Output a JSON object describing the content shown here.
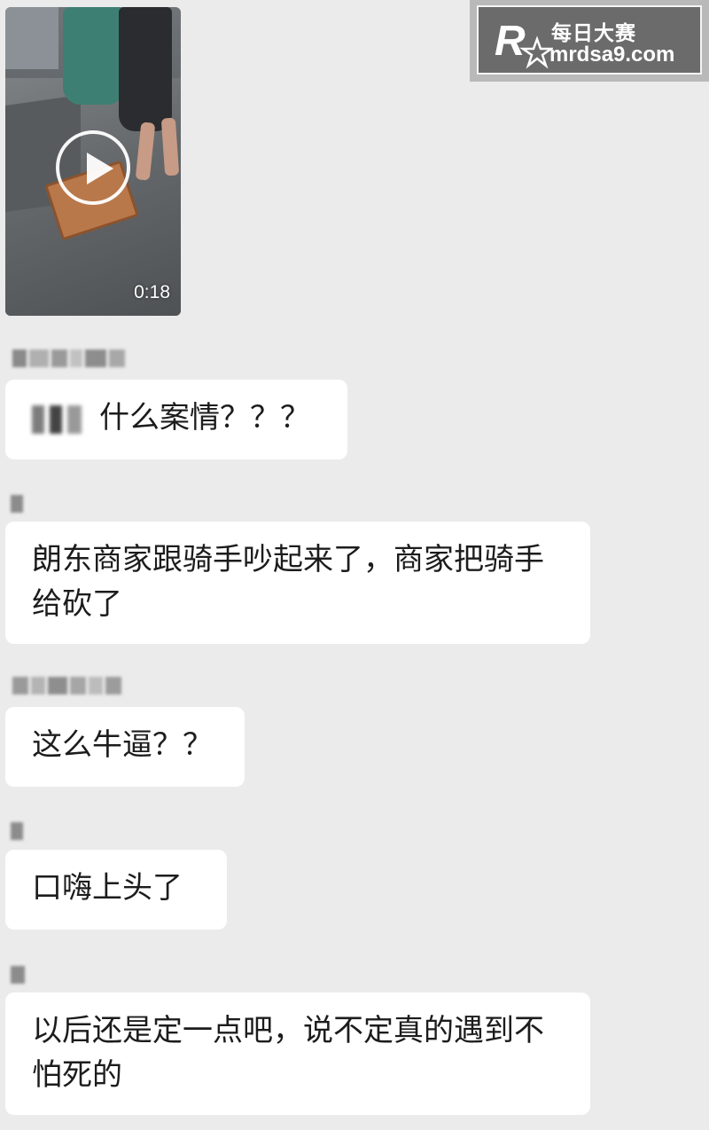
{
  "video": {
    "duration": "0:18",
    "play_icon": "play-icon"
  },
  "watermark": {
    "logo_letter": "R",
    "logo_small": "每日大赛",
    "title": "每日大赛",
    "url": "mrdsa9.com"
  },
  "messages": [
    {
      "sender": "",
      "text": "什么案情？？？",
      "has_mention": true
    },
    {
      "sender": "",
      "text": "朗东商家跟骑手吵起来了，商家把骑手给砍了",
      "has_mention": false
    },
    {
      "sender": "",
      "text": "这么牛逼？？",
      "has_mention": false
    },
    {
      "sender": "",
      "text": "口嗨上头了",
      "has_mention": false
    },
    {
      "sender": "",
      "text": "以后还是定一点吧，说不定真的遇到不怕死的",
      "has_mention": false
    }
  ],
  "colors": {
    "background": "#ebebeb",
    "bubble": "#ffffff",
    "text": "#1c1c1c"
  }
}
